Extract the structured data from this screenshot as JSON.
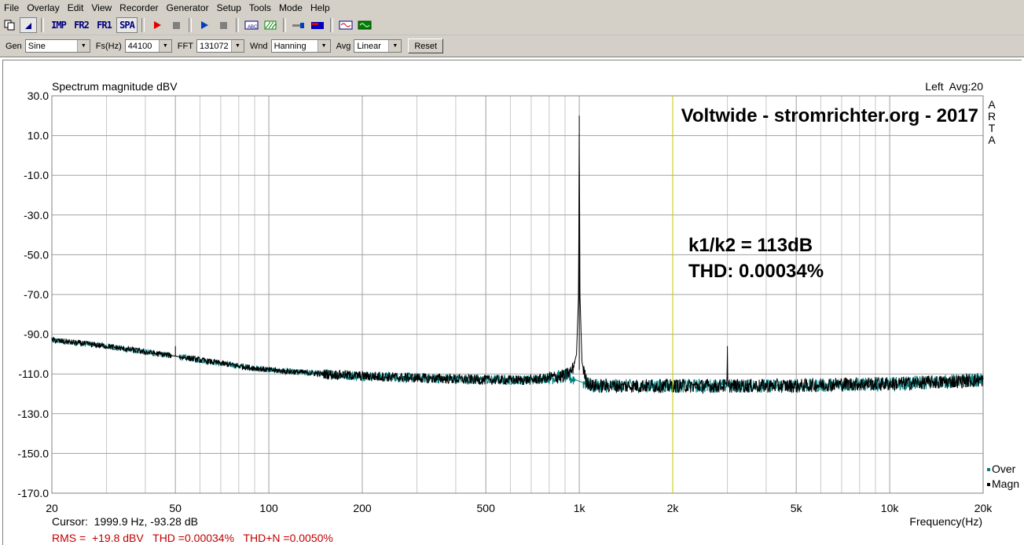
{
  "menu": [
    "File",
    "Overlay",
    "Edit",
    "View",
    "Recorder",
    "Generator",
    "Setup",
    "Tools",
    "Mode",
    "Help"
  ],
  "toolbar": {
    "imp": "IMP",
    "fr2": "FR2",
    "fr1": "FR1",
    "spa": "SPA"
  },
  "controls": {
    "gen_label": "Gen",
    "gen_value": "Sine",
    "fs_label": "Fs(Hz)",
    "fs_value": "44100",
    "fft_label": "FFT",
    "fft_value": "131072",
    "wnd_label": "Wnd",
    "wnd_value": "Hanning",
    "avg_label": "Avg",
    "avg_value": "Linear",
    "reset_label": "Reset"
  },
  "plot": {
    "title": "Spectrum magnitude dBV",
    "channel_info": "Left  Avg:20",
    "banner": "Voltwide - stromrichter.org - 2017",
    "annotation_line1": "k1/k2 = 113dB",
    "annotation_line2": "THD: 0.00034%",
    "arta_letters": [
      "A",
      "R",
      "T",
      "A"
    ],
    "xlabel": "Frequency(Hz)",
    "cursor_text": "Cursor:  1999.9 Hz, -93.28 dB",
    "stats_text": "RMS =  +19.8 dBV   THD =0.00034%   THD+N =0.0050%",
    "legend": [
      {
        "name": "Over",
        "color": "#008080"
      },
      {
        "name": "Magn",
        "color": "#000000"
      }
    ],
    "cursor_color": "#c8c800",
    "stats_color": "#c00000"
  },
  "chart_data": {
    "type": "line",
    "title": "Spectrum magnitude dBV",
    "xlabel": "Frequency(Hz)",
    "ylabel": "",
    "xscale": "log",
    "xlim": [
      20,
      20000
    ],
    "ylim": [
      -170,
      30
    ],
    "x_ticks": [
      20,
      50,
      100,
      200,
      500,
      1000,
      2000,
      5000,
      10000,
      20000
    ],
    "x_tick_labels": [
      "20",
      "50",
      "100",
      "200",
      "500",
      "1k",
      "2k",
      "5k",
      "10k",
      "20k"
    ],
    "y_ticks": [
      30,
      10,
      -10,
      -30,
      -50,
      -70,
      -90,
      -110,
      -130,
      -150,
      -170
    ],
    "y_tick_labels": [
      "30.0",
      "10.0",
      "-10.0",
      "-30.0",
      "-50.0",
      "-70.0",
      "-90.0",
      "-110.0",
      "-130.0",
      "-150.0",
      "-170.0"
    ],
    "grid": true,
    "cursor_x": 1999.9,
    "series": [
      {
        "name": "Magn",
        "color": "#000000",
        "x": [
          20,
          30,
          40,
          50,
          60,
          80,
          100,
          150,
          200,
          300,
          500,
          700,
          900,
          950,
          980,
          995,
          1000,
          1005,
          1020,
          1050,
          1100,
          1500,
          2000,
          2990,
          3000,
          3010,
          4000,
          5000,
          7000,
          10000,
          15000,
          20000
        ],
        "y": [
          -93,
          -96,
          -99,
          -101,
          -103,
          -106,
          -108,
          -110,
          -111,
          -112,
          -113,
          -113,
          -111,
          -108,
          -100,
          -70,
          20,
          -70,
          -104,
          -113,
          -116,
          -116,
          -116,
          -116,
          -96,
          -116,
          -116,
          -116,
          -115,
          -115,
          -114,
          -113
        ]
      },
      {
        "name": "Over",
        "color": "#008080",
        "x": [
          20,
          30,
          40,
          50,
          60,
          80,
          100,
          150,
          200,
          300,
          500,
          700,
          900,
          1100,
          1500,
          2000,
          3000,
          5000,
          10000,
          20000
        ],
        "y": [
          -93,
          -96,
          -99,
          -101,
          -103,
          -106,
          -108,
          -110,
          -111,
          -112,
          -113,
          -113,
          -111,
          -116,
          -116,
          -116,
          -116,
          -116,
          -115,
          -113
        ]
      }
    ]
  }
}
